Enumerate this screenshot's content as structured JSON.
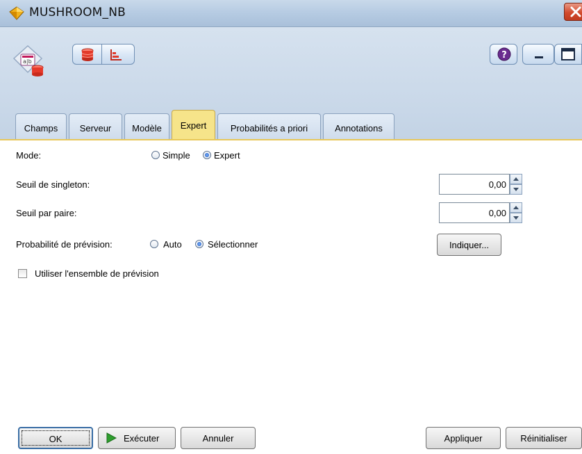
{
  "window": {
    "title": "MUSHROOM_NB"
  },
  "tabs": [
    "Champs",
    "Serveur",
    "Modèle",
    "Expert",
    "Probabilités a priori",
    "Annotations"
  ],
  "active_tab": "Expert",
  "form": {
    "mode_label": "Mode:",
    "mode_options": [
      "Simple",
      "Expert"
    ],
    "mode_selected": "Expert",
    "singleton_label": "Seuil de singleton:",
    "singleton_value": "0,00",
    "pair_label": "Seuil par paire:",
    "pair_value": "0,00",
    "prob_label": "Probabilité de prévision:",
    "prob_options": [
      "Auto",
      "Sélectionner"
    ],
    "prob_selected": "Sélectionner",
    "specify_button": "Indiquer...",
    "use_set_label": "Utiliser l'ensemble de prévision",
    "use_set_checked": false
  },
  "buttons": {
    "ok": "OK",
    "run": "Exécuter",
    "cancel": "Annuler",
    "apply": "Appliquer",
    "reset": "Réinitialiser"
  },
  "icons": {
    "title": "diamond-node-icon",
    "node": "model-nugget-icon",
    "toolbar": [
      "database-icon",
      "chart-icon",
      "help-icon",
      "minimize-icon",
      "maximize-icon"
    ]
  },
  "colors": {
    "active_tab": "#f6e48a",
    "title_bar": "#b7cce3",
    "run_arrow": "#2e9e2e"
  }
}
